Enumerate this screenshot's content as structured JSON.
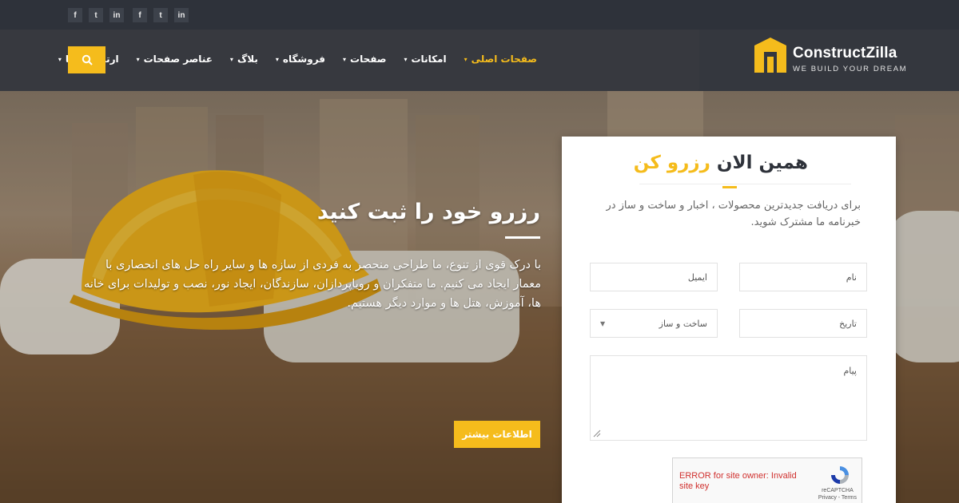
{
  "social": [
    "f",
    "t",
    "in",
    "f",
    "t",
    "in"
  ],
  "logo": {
    "title": "ConstructZilla",
    "tagline": "WE BUILD YOUR DREAM"
  },
  "nav": {
    "items": [
      {
        "label": "صفحات اصلی",
        "active": true
      },
      {
        "label": "امکانات",
        "active": false
      },
      {
        "label": "صفحات",
        "active": false
      },
      {
        "label": "فروشگاه",
        "active": false
      },
      {
        "label": "بلاگ",
        "active": false
      },
      {
        "label": "عناصر صفحات",
        "active": false
      },
      {
        "label": "ارتباط با ما",
        "active": false
      }
    ]
  },
  "hero": {
    "title": "رزرو خود را ثبت کنید",
    "text": "با درک قوی از تنوع، ما طراحی منحصر به فردی از سازه ها و سایر راه حل های انحصاری با معمار ایجاد می کنیم. ما متفکران و رویاپردازان، سازندگان، ایجاد نور، نصب و تولیدات برای خانه ها، آموزش، هتل ها و موارد دیگر هستیم.",
    "button": "اطلاعات بیشتر"
  },
  "form": {
    "title_main": "همین الان",
    "title_highlight": "رزرو کن",
    "description": "برای دریافت جدیدترین محصولات ، اخبار و ساخت و ساز در خبرنامه ما مشترک شوید.",
    "name_placeholder": "نام",
    "email_placeholder": "ایمیل",
    "date_placeholder": "تاریخ",
    "select_value": "ساخت و ساز",
    "message_placeholder": "پیام",
    "captcha_error": "ERROR for site owner: Invalid site key",
    "captcha_brand": "reCAPTCHA",
    "captcha_links": "Privacy - Terms"
  },
  "colors": {
    "accent": "#f5bc1c",
    "dark": "#2e323a"
  }
}
